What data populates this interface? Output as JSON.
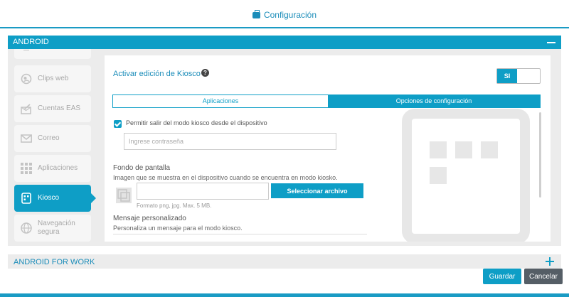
{
  "header": {
    "title": "Configuración",
    "icon": "briefcase-icon"
  },
  "android_panel": {
    "title": "ANDROID",
    "collapse_icon": "minus-icon"
  },
  "sidebar": {
    "items": [
      {
        "label": "Clips web",
        "icon": "web-clip-icon",
        "active": false
      },
      {
        "label": "Cuentas EAS",
        "icon": "eas-account-icon",
        "active": false
      },
      {
        "label": "Correo",
        "icon": "mail-icon",
        "active": false
      },
      {
        "label": "Aplicaciones",
        "icon": "apps-grid-icon",
        "active": false
      },
      {
        "label": "Kiosco",
        "icon": "kiosk-icon",
        "active": true
      },
      {
        "label": "Navegación segura",
        "icon": "globe-icon",
        "active": false
      }
    ]
  },
  "main": {
    "heading": "Activar edición de Kiosco",
    "toggle_label": "SI",
    "tabs": [
      {
        "label": "Aplicaciones",
        "active": false
      },
      {
        "label": "Opciones de configuración",
        "active": true
      }
    ],
    "allow_exit_label": "Permitir salir del modo kiosco desde el dispositivo",
    "allow_exit_checked": true,
    "password_placeholder": "Ingrese contraseña",
    "wallpaper_title": "Fondo de pantalla",
    "wallpaper_desc": "Imagen que se muestra en el dispositivo cuando se encuentra en modo kiosko.",
    "select_file_label": "Seleccionar archivo",
    "format_hint": "Formato png, jpg. Max. 5 MB.",
    "message_title": "Mensaje personalizado",
    "message_desc": "Personaliza un mensaje para el modo kiosco."
  },
  "android_work_panel": {
    "title": "ANDROID FOR WORK",
    "expand_icon": "plus-icon"
  },
  "footer": {
    "save_label": "Guardar",
    "cancel_label": "Cancelar"
  },
  "colors": {
    "accent": "#0e9ec6",
    "cancel": "#555e66",
    "panel_bg": "#ececec"
  }
}
